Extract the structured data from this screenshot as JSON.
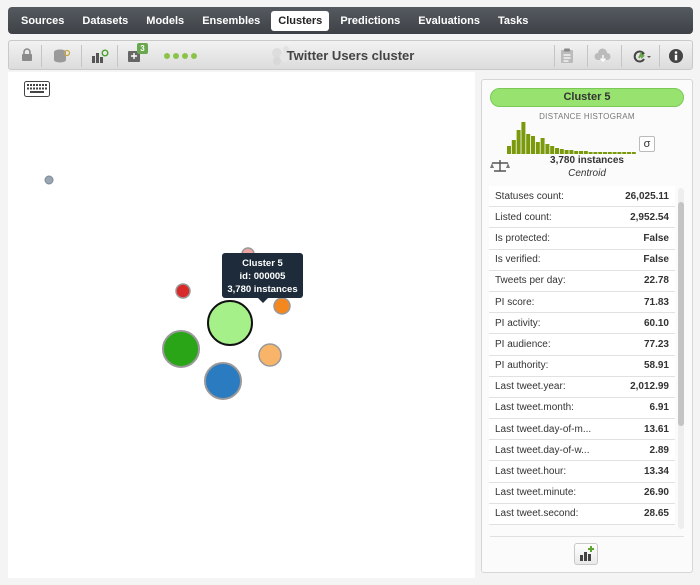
{
  "nav": {
    "items": [
      "Sources",
      "Datasets",
      "Models",
      "Ensembles",
      "Clusters",
      "Predictions",
      "Evaluations",
      "Tasks"
    ],
    "active": "Clusters"
  },
  "toolbar": {
    "title": "Twitter Users cluster",
    "badge_count": "3",
    "icons": [
      "lock-icon",
      "dataset-search-icon",
      "model-search-icon",
      "batch-icon",
      "loading-dots-icon",
      "cluster-graph-icon",
      "clipboard-icon",
      "cloud-download-icon",
      "refresh-icon",
      "info-icon"
    ]
  },
  "graph": {
    "tooltip": {
      "line1": "Cluster 5",
      "line2": "id: 000005",
      "line3": "3,780 instances"
    },
    "colors": {
      "selected": "#a6f08a",
      "green": "#2aa518",
      "blue": "#2a7bc0",
      "orange_light": "#f8b56a",
      "orange": "#f5871f",
      "red": "#d92a2a",
      "pink": "#f0a4a4",
      "gray": "#9aa7b3"
    }
  },
  "panel": {
    "cluster_name": "Cluster 5",
    "histogram_title": "DISTANCE HISTOGRAM",
    "histogram_values": [
      4,
      7,
      12,
      16,
      10,
      9,
      6,
      8,
      5,
      4,
      3,
      2.5,
      2,
      2,
      1.5,
      1.5,
      1.5,
      1,
      1,
      1,
      1,
      1,
      1,
      1,
      1,
      1,
      1
    ],
    "sigma_label": "σ",
    "instances": "3,780 instances",
    "centroid_label": "Centroid",
    "rows": [
      {
        "label": "Statuses count:",
        "value": "26,025.11"
      },
      {
        "label": "Listed count:",
        "value": "2,952.54"
      },
      {
        "label": "Is protected:",
        "value": "False"
      },
      {
        "label": "Is verified:",
        "value": "False"
      },
      {
        "label": "Tweets per day:",
        "value": "22.78"
      },
      {
        "label": "PI score:",
        "value": "71.83"
      },
      {
        "label": "PI activity:",
        "value": "60.10"
      },
      {
        "label": "PI audience:",
        "value": "77.23"
      },
      {
        "label": "PI authority:",
        "value": "58.91"
      },
      {
        "label": "Last tweet.year:",
        "value": "2,012.99"
      },
      {
        "label": "Last tweet.month:",
        "value": "6.91"
      },
      {
        "label": "Last tweet.day-of-m...",
        "value": "13.61"
      },
      {
        "label": "Last tweet.day-of-w...",
        "value": "2.89"
      },
      {
        "label": "Last tweet.hour:",
        "value": "13.34"
      },
      {
        "label": "Last tweet.minute:",
        "value": "26.90"
      },
      {
        "label": "Last tweet.second:",
        "value": "28.65"
      }
    ]
  }
}
